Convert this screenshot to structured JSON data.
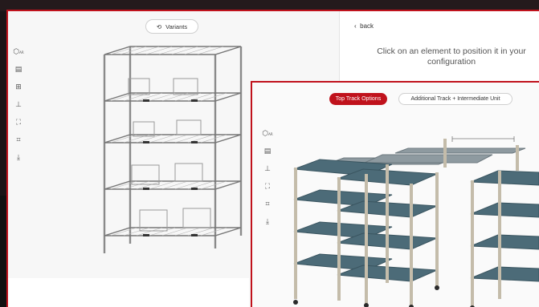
{
  "main": {
    "variants_label": "Variants",
    "back_label": "back",
    "hint_text": "Click on an element to position it in your configuration",
    "tools": [
      {
        "icon": "ar-cube-icon",
        "glyph": "⬡",
        "sub": "AR"
      },
      {
        "icon": "clipboard-icon",
        "glyph": "▤"
      },
      {
        "icon": "add-box-icon",
        "glyph": "⊞"
      },
      {
        "icon": "measure-icon",
        "glyph": "⊥"
      },
      {
        "icon": "fullscreen-icon",
        "glyph": "⛶"
      },
      {
        "icon": "dimensions-icon",
        "glyph": "⌗"
      },
      {
        "icon": "download-pdf-icon",
        "glyph": "⤓"
      }
    ]
  },
  "overlay": {
    "tab_active": "Top Track Options",
    "tab_other": "Additional Track + Intermediate Unit",
    "tools": [
      {
        "icon": "ar-cube-icon",
        "glyph": "⬡",
        "sub": "AR"
      },
      {
        "icon": "clipboard-icon",
        "glyph": "▤"
      },
      {
        "icon": "measure-icon",
        "glyph": "⊥"
      },
      {
        "icon": "fullscreen-icon",
        "glyph": "⛶"
      },
      {
        "icon": "dimensions-icon",
        "glyph": "⌗"
      },
      {
        "icon": "download-pdf-icon",
        "glyph": "⤓"
      }
    ]
  },
  "colors": {
    "accent": "#c0121c",
    "shelf_blue": "#4c6b78",
    "wire": "#8a8a8a"
  }
}
